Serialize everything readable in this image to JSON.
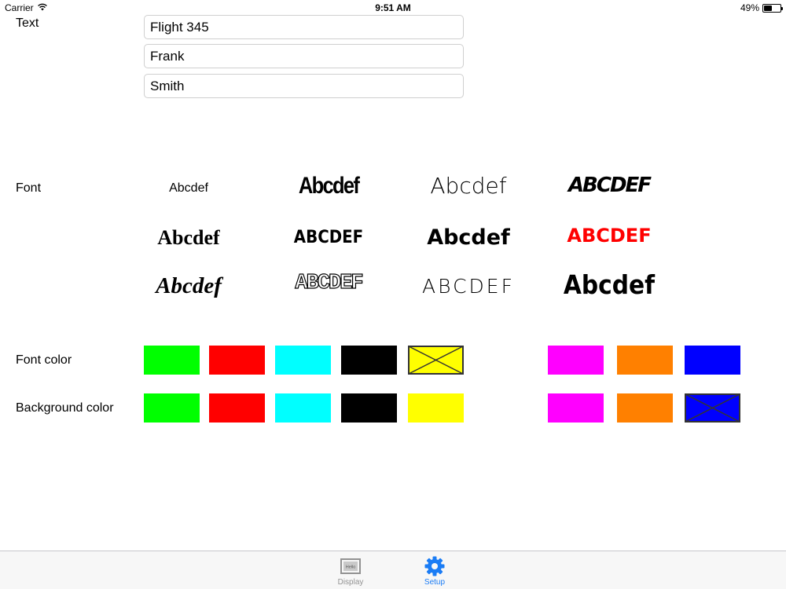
{
  "status_bar": {
    "carrier": "Carrier",
    "time": "9:51 AM",
    "battery": "49%",
    "battery_level": 0.49
  },
  "labels": {
    "text": "Text",
    "font": "Font",
    "font_color": "Font color",
    "background_color": "Background color"
  },
  "text_fields": [
    "Flight 345",
    "Frank",
    "Smith"
  ],
  "font_samples": [
    "Abcdef",
    "Abcdef",
    "Abcdef",
    "ABCDEF",
    "Abcdef",
    "ABCDEF",
    "Abcdef",
    "ABCDEF",
    "Abcdef",
    "ABCDEF",
    "ABCDEF",
    "Abcdef"
  ],
  "font_sample_colors": [
    "#000000",
    "#000000",
    "#000000",
    "#000000",
    "#000000",
    "#000000",
    "#000000",
    "#ff0000",
    "#000000",
    "#000000",
    "#000000",
    "#000000"
  ],
  "font_colors": [
    "#00ff00",
    "#ff0000",
    "#00ffff",
    "#000000",
    "#ffff00",
    "#ff00ff",
    "#ff8000",
    "#0000ff"
  ],
  "font_colors_selected_index": 4,
  "background_colors": [
    "#00ff00",
    "#ff0000",
    "#00ffff",
    "#000000",
    "#ffff00",
    "#ff00ff",
    "#ff8000",
    "#0000ff"
  ],
  "background_colors_selected_index": 7,
  "tab_bar": {
    "tabs": [
      {
        "label": "Display",
        "icon": "display-icon",
        "icon_text": "Hello",
        "active": false
      },
      {
        "label": "Setup",
        "icon": "gear-icon",
        "active": true
      }
    ],
    "active_color": "#1a7cf5",
    "inactive_color": "#929292"
  }
}
